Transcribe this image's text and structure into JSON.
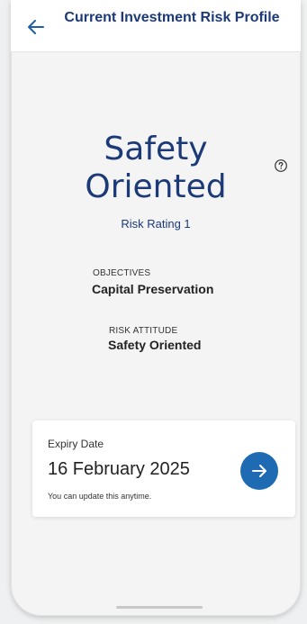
{
  "header": {
    "title": "Current Investment Risk Profile",
    "back_icon": "arrow-left-icon"
  },
  "profile": {
    "name_line1": "Safety",
    "name_line2": "Oriented",
    "help_icon": "question-circle-icon",
    "risk_rating": "Risk Rating 1"
  },
  "objectives": {
    "label": "OBJECTIVES",
    "value": "Capital Preservation"
  },
  "risk_attitude": {
    "label": "RISK ATTITUDE",
    "value": "Safety Oriented"
  },
  "expiry_card": {
    "label": "Expiry Date",
    "date": "16 February 2025",
    "note": "You can update this anytime.",
    "action_icon": "arrow-right-icon"
  },
  "colors": {
    "brand_navy": "#1d3a78",
    "action_blue": "#1f6bb3",
    "background": "#f4f4f4"
  }
}
